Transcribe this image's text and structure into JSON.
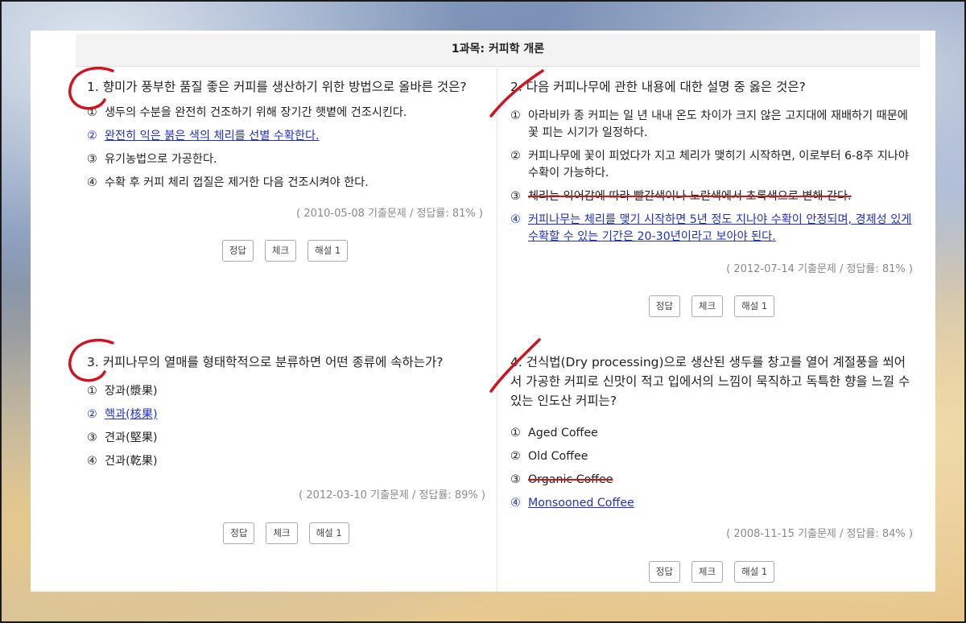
{
  "header": {
    "title": "1과목: 커피학 개론"
  },
  "questions": [
    {
      "title": "1. 향미가 풍부한 품질 좋은 커피를 생산하기 위한 방법으로 올바른 것은?",
      "options": [
        {
          "num": "①",
          "text": "생두의 수분을 완전히 건조하기 위해 장기간 햇볕에 건조시킨다.",
          "state": "normal"
        },
        {
          "num": "②",
          "text": "완전히 익은 붉은 색의 체리를 선별 수확한다.",
          "state": "correct"
        },
        {
          "num": "③",
          "text": "유기농법으로 가공한다.",
          "state": "normal"
        },
        {
          "num": "④",
          "text": "수확 후 커피 체리 껍질은 제거한 다음 건조시켜야 한다.",
          "state": "normal"
        }
      ],
      "meta": "( 2010-05-08 기출문제 / 정답률: 81% )",
      "buttons": [
        "정답",
        "체크",
        "해설 1"
      ]
    },
    {
      "title": "2. 다음 커피나무에 관한 내용에 대한 설명 중 옳은 것은?",
      "options": [
        {
          "num": "①",
          "text": "아라비카 종 커피는 일 년 내내 온도 차이가 크지 않은 고지대에 재배하기 때문에 꽃 피는 시기가 일정하다.",
          "state": "normal"
        },
        {
          "num": "②",
          "text": "커피나무에 꽃이 피었다가 지고 체리가 맺히기 시작하면, 이로부터 6-8주 지나야 수확이 가능하다.",
          "state": "normal"
        },
        {
          "num": "③",
          "text": "체리는 익어감에 따라 빨간색이나 노란색에서 초록색으로 변해 간다.",
          "state": "struck"
        },
        {
          "num": "④",
          "text": "커피나무는 체리를 맺기 시작하면 5년 정도 지나야 수확이 안정되며, 경제성 있게 수확할 수 있는 기간은 20-30년이라고 보아야 된다.",
          "state": "correct"
        }
      ],
      "meta": "( 2012-07-14 기출문제 / 정답률: 81% )",
      "buttons": [
        "정답",
        "체크",
        "해설 1"
      ]
    },
    {
      "title": "3. 커피나무의 열매를 형태학적으로 분류하면 어떤 종류에 속하는가?",
      "options": [
        {
          "num": "①",
          "text": "장과(漿果)",
          "state": "normal"
        },
        {
          "num": "②",
          "text": "핵과(核果)",
          "state": "correct"
        },
        {
          "num": "③",
          "text": "견과(堅果)",
          "state": "normal"
        },
        {
          "num": "④",
          "text": "건과(乾果)",
          "state": "normal"
        }
      ],
      "meta": "( 2012-03-10 기출문제 / 정답률: 89% )",
      "buttons": [
        "정답",
        "체크",
        "해설 1"
      ]
    },
    {
      "title": "4. 건식법(Dry processing)으로 생산된 생두를 창고를 열어 계절풍을 쐬어서 가공한 커피로 신맛이 적고 입에서의 느낌이 묵직하고 독특한 향을 느낄 수 있는 인도산 커피는?",
      "options": [
        {
          "num": "①",
          "text": "Aged Coffee",
          "state": "normal"
        },
        {
          "num": "②",
          "text": "Old Coffee",
          "state": "normal"
        },
        {
          "num": "③",
          "text": "Organic Coffee",
          "state": "struck"
        },
        {
          "num": "④",
          "text": "Monsooned Coffee",
          "state": "correct"
        }
      ],
      "meta": "( 2008-11-15 기출문제 / 정답률: 84% )",
      "buttons": [
        "정답",
        "체크",
        "해설 1"
      ]
    }
  ],
  "colors": {
    "correct": "#2330c8",
    "strike": "#d0141f",
    "mark": "#d0141f"
  }
}
